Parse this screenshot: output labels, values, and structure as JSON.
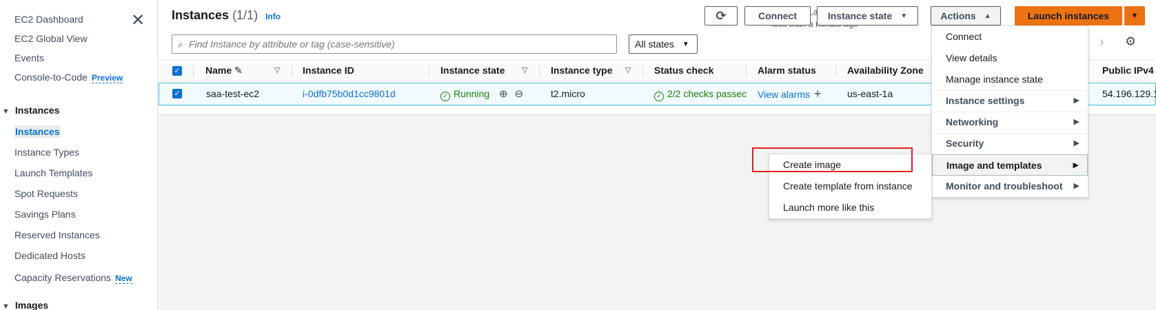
{
  "sidebar": {
    "close_icon": "close-icon",
    "items": [
      {
        "label": "EC2 Dashboard"
      },
      {
        "label": "EC2 Global View"
      },
      {
        "label": "Events"
      },
      {
        "label": "Console-to-Code",
        "badge": "Preview"
      }
    ],
    "instances_section": "Instances",
    "instances_items": [
      {
        "label": "Instances",
        "active": true
      },
      {
        "label": "Instance Types"
      },
      {
        "label": "Launch Templates"
      },
      {
        "label": "Spot Requests"
      },
      {
        "label": "Savings Plans"
      },
      {
        "label": "Reserved Instances"
      },
      {
        "label": "Dedicated Hosts"
      },
      {
        "label": "Capacity Reservations",
        "badge": "New"
      }
    ],
    "images_section": "Images"
  },
  "header": {
    "title": "Instances",
    "count": "(1/1)",
    "info": "Info",
    "updated_line1": "Last updated",
    "updated_line2": "less than a minute ago",
    "connect": "Connect",
    "instance_state": "Instance state",
    "actions": "Actions",
    "launch": "Launch instances"
  },
  "search": {
    "placeholder": "Find Instance by attribute or tag (case-sensitive)",
    "states_filter": "All states"
  },
  "table": {
    "columns": [
      "Name",
      "Instance ID",
      "Instance state",
      "Instance type",
      "Status check",
      "Alarm status",
      "Availability Zone",
      "Public IPv4"
    ],
    "row": {
      "name": "saa-test-ec2",
      "instance_id": "i-0dfb75b0d1cc9801d",
      "state": "Running",
      "type": "t2.micro",
      "status_check": "2/2 checks passec",
      "alarm": "View alarms",
      "az": "us-east-1a",
      "ipv4": "54.196.129.1"
    }
  },
  "actions_menu": {
    "items": [
      "Connect",
      "View details",
      "Manage instance state"
    ],
    "submenus": [
      "Instance settings",
      "Networking",
      "Security",
      "Image and templates",
      "Monitor and troubleshoot"
    ]
  },
  "image_submenu": {
    "items": [
      "Create image",
      "Create template from instance",
      "Launch more like this"
    ]
  },
  "colors": {
    "accent": "#0972d3",
    "orange": "#ec7211",
    "running": "#1d8102",
    "highlight_box": "#e02020"
  }
}
